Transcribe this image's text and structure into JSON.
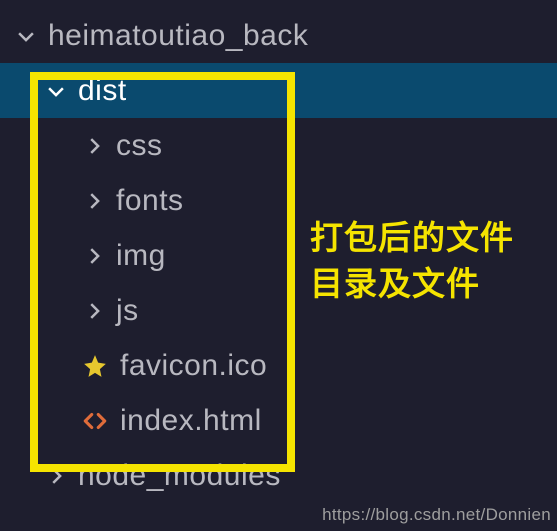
{
  "tree": {
    "root": {
      "label": "heimatoutiao_back",
      "expanded": true
    },
    "items": [
      {
        "label": "dist",
        "type": "folder",
        "expanded": true,
        "selected": true,
        "level": 1
      },
      {
        "label": "css",
        "type": "folder",
        "expanded": false,
        "level": 2
      },
      {
        "label": "fonts",
        "type": "folder",
        "expanded": false,
        "level": 2
      },
      {
        "label": "img",
        "type": "folder",
        "expanded": false,
        "level": 2
      },
      {
        "label": "js",
        "type": "folder",
        "expanded": false,
        "level": 2
      },
      {
        "label": "favicon.ico",
        "type": "file",
        "icon": "star",
        "level": 2
      },
      {
        "label": "index.html",
        "type": "file",
        "icon": "html",
        "level": 2
      },
      {
        "label": "node_modules",
        "type": "folder",
        "expanded": false,
        "level": 1
      }
    ]
  },
  "annotation": {
    "line1": "打包后的文件",
    "line2": "目录及文件"
  },
  "highlight": {
    "color": "#f5e400"
  },
  "watermark": "https://blog.csdn.net/Donnien"
}
